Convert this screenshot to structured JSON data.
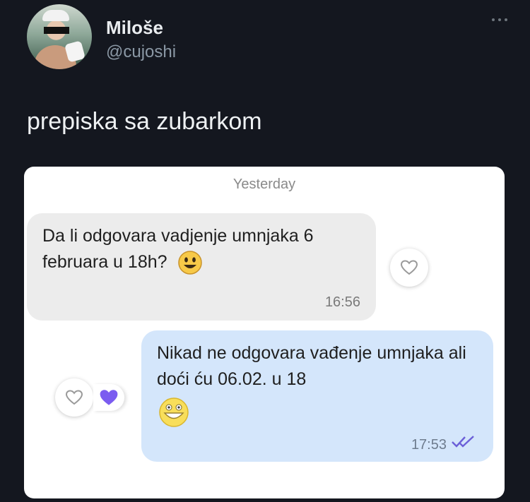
{
  "tweet": {
    "display_name": "Miloše",
    "handle": "@cujoshi",
    "text": "prepiska sa zubarkom",
    "more_icon": "more-horizontal-icon"
  },
  "chat": {
    "day_label": "Yesterday",
    "messages": [
      {
        "direction": "incoming",
        "text": "Da li odgovara vadjenje umnjaka 6 februara u 18h?",
        "emoji": "smiling-face-icon",
        "time": "16:56",
        "reaction": "heart-outline-icon"
      },
      {
        "direction": "outgoing",
        "text": "Nikad ne odgovara vađenje umnjaka ali doći ću 06.02. u 18",
        "emoji": "grinning-face-icon",
        "time": "17:53",
        "status_icon": "double-check-icon",
        "reactions": [
          "heart-outline-icon",
          "heart-filled-icon"
        ]
      }
    ],
    "colors": {
      "incoming_bubble": "#ececec",
      "outgoing_bubble": "#d4e6fb",
      "heart_filled": "#7b5cf0",
      "read_ticks": "#6b5fd8"
    }
  }
}
